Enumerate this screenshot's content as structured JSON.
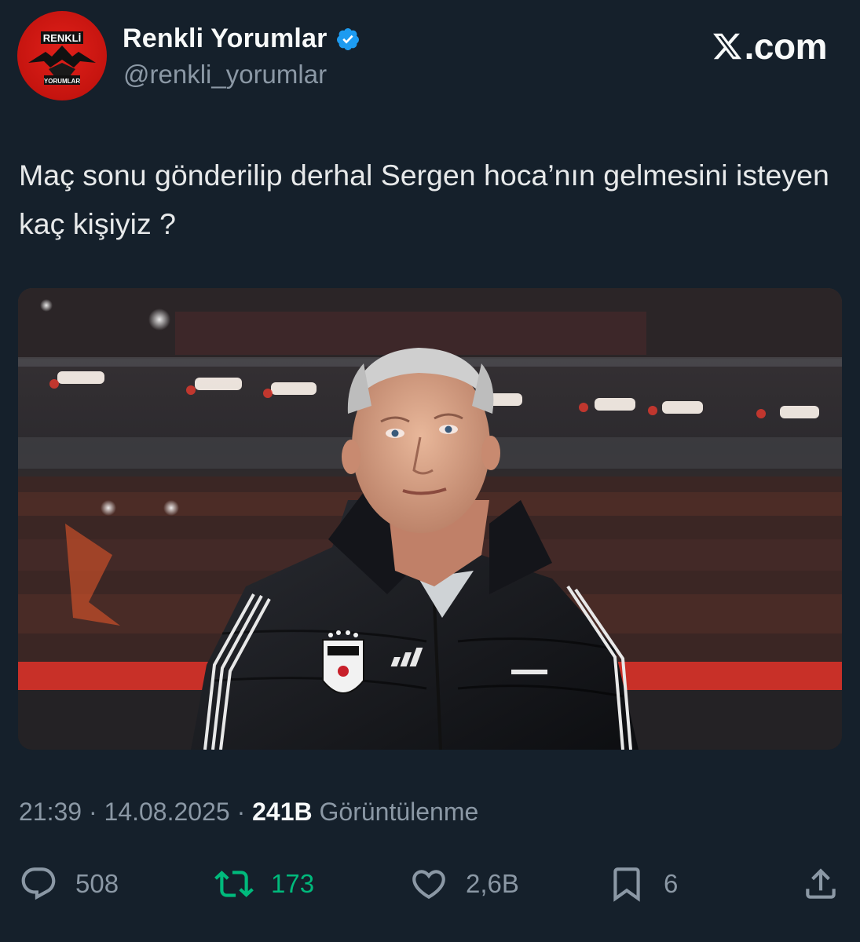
{
  "account": {
    "display_name": "Renkli Yorumlar",
    "handle": "@renkli_yorumlar",
    "verified_icon": "verified-badge-icon",
    "avatar_text_top": "RENKLİ",
    "avatar_text_bottom": "YORUMLAR"
  },
  "brand": {
    "label": ".com",
    "icon": "x-logo-icon"
  },
  "tweet": {
    "text": "Maç sonu gönderilip derhal Sergen hoca’nın gelmesini isteyen kaç kişiyiz ?",
    "image_alt": "Coach in black Beşiktaş jacket standing in a stadium"
  },
  "meta": {
    "time": "21:39",
    "separator": "·",
    "date": "14.08.2025",
    "views_count": "241B",
    "views_label": "Görüntülenme"
  },
  "actions": {
    "replies": "508",
    "retweets": "173",
    "likes": "2,6B",
    "bookmarks": "6"
  },
  "colors": {
    "background": "#15202b",
    "secondary_text": "#8b98a5",
    "retweet_green": "#00ba7c",
    "verified_blue": "#1d9bf0"
  }
}
